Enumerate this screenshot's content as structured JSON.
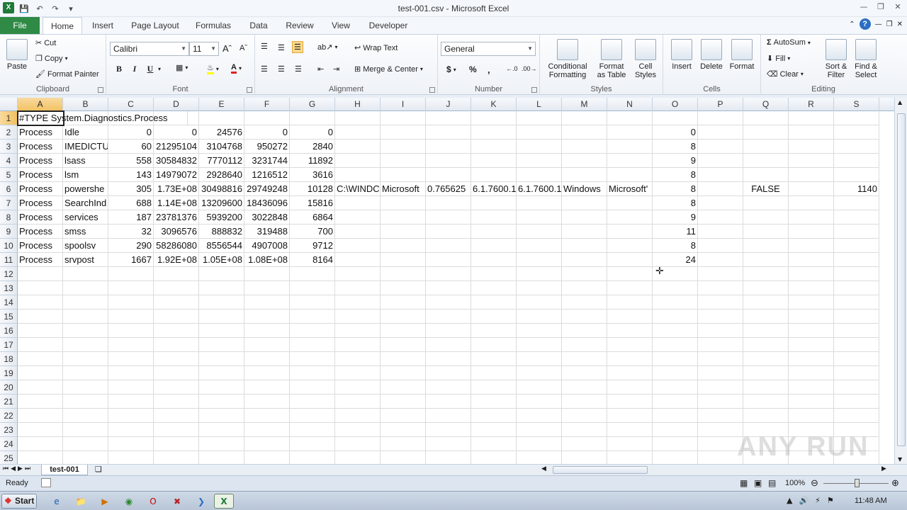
{
  "window": {
    "title": "test-001.csv - Microsoft Excel"
  },
  "ribbon": {
    "tabs": [
      "File",
      "Home",
      "Insert",
      "Page Layout",
      "Formulas",
      "Data",
      "Review",
      "View",
      "Developer"
    ],
    "clipboard": {
      "label": "Clipboard",
      "paste": "Paste",
      "cut": "Cut",
      "copy": "Copy",
      "format_painter": "Format Painter"
    },
    "font": {
      "label": "Font",
      "name": "Calibri",
      "size": "11",
      "bold": "B",
      "italic": "I",
      "underline": "U"
    },
    "alignment": {
      "label": "Alignment",
      "wrap": "Wrap Text",
      "merge": "Merge & Center"
    },
    "number": {
      "label": "Number",
      "format": "General",
      "currency": "$",
      "percent": "%",
      "comma": ","
    },
    "styles": {
      "label": "Styles",
      "conditional": "Conditional\nFormatting",
      "format_table": "Format\nas Table",
      "cell_styles": "Cell\nStyles"
    },
    "cells": {
      "label": "Cells",
      "insert": "Insert",
      "delete": "Delete",
      "format": "Format"
    },
    "editing": {
      "label": "Editing",
      "autosum": "AutoSum",
      "fill": "Fill",
      "clear": "Clear",
      "sort": "Sort &\nFilter",
      "find": "Find &\nSelect"
    }
  },
  "sheet": {
    "columns": [
      "A",
      "B",
      "C",
      "D",
      "E",
      "F",
      "G",
      "H",
      "I",
      "J",
      "K",
      "L",
      "M",
      "N",
      "O",
      "P",
      "Q",
      "R",
      "S"
    ],
    "row_numbers": [
      "1",
      "2",
      "3",
      "4",
      "5",
      "6",
      "7",
      "8",
      "9",
      "10",
      "11",
      "12",
      "13",
      "14",
      "15",
      "16",
      "17",
      "18",
      "19",
      "20",
      "21",
      "22",
      "23",
      "24",
      "25"
    ],
    "row1": "#TYPE System.Diagnostics.Process",
    "rows": [
      [
        "Process",
        "Idle",
        "0",
        "0",
        "24576",
        "0",
        "0",
        "",
        "",
        "",
        "",
        "",
        "",
        "",
        "0",
        "",
        "",
        "",
        ""
      ],
      [
        "Process",
        "IMEDICTU",
        "60",
        "21295104",
        "3104768",
        "950272",
        "2840",
        "",
        "",
        "",
        "",
        "",
        "",
        "",
        "8",
        "",
        "",
        "",
        ""
      ],
      [
        "Process",
        "lsass",
        "558",
        "30584832",
        "7770112",
        "3231744",
        "11892",
        "",
        "",
        "",
        "",
        "",
        "",
        "",
        "9",
        "",
        "",
        "",
        ""
      ],
      [
        "Process",
        "lsm",
        "143",
        "14979072",
        "2928640",
        "1216512",
        "3616",
        "",
        "",
        "",
        "",
        "",
        "",
        "",
        "8",
        "",
        "",
        "",
        ""
      ],
      [
        "Process",
        "powershe",
        "305",
        "1.73E+08",
        "30498816",
        "29749248",
        "10128",
        "C:\\WINDC",
        "Microsoft",
        "0.765625",
        "6.1.7600.1",
        "6.1.7600.1",
        "Windows",
        "Microsoft'",
        "8",
        "",
        "FALSE",
        "",
        "1140"
      ],
      [
        "Process",
        "SearchInd",
        "688",
        "1.14E+08",
        "13209600",
        "18436096",
        "15816",
        "",
        "",
        "",
        "",
        "",
        "",
        "",
        "8",
        "",
        "",
        "",
        ""
      ],
      [
        "Process",
        "services",
        "187",
        "23781376",
        "5939200",
        "3022848",
        "6864",
        "",
        "",
        "",
        "",
        "",
        "",
        "",
        "9",
        "",
        "",
        "",
        ""
      ],
      [
        "Process",
        "smss",
        "32",
        "3096576",
        "888832",
        "319488",
        "700",
        "",
        "",
        "",
        "",
        "",
        "",
        "",
        "11",
        "",
        "",
        "",
        ""
      ],
      [
        "Process",
        "spoolsv",
        "290",
        "58286080",
        "8556544",
        "4907008",
        "9712",
        "",
        "",
        "",
        "",
        "",
        "",
        "",
        "8",
        "",
        "",
        "",
        ""
      ],
      [
        "Process",
        "srvpost",
        "1667",
        "1.92E+08",
        "1.05E+08",
        "1.08E+08",
        "8164",
        "",
        "",
        "",
        "",
        "",
        "",
        "",
        "24",
        "",
        "",
        "",
        ""
      ]
    ],
    "tab_name": "test-001"
  },
  "status": {
    "ready": "Ready",
    "zoom": "100%"
  },
  "taskbar": {
    "start": "Start",
    "time": "11:48 AM"
  },
  "watermark": "ANY RUN"
}
